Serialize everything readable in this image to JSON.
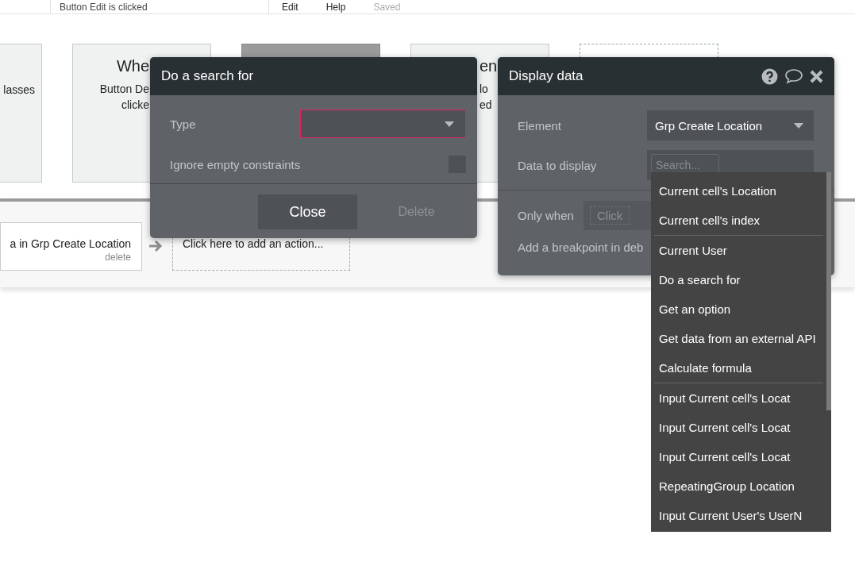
{
  "top_bar": {
    "event_name": "Button Edit is clicked",
    "menu": [
      "Edit",
      "Help"
    ],
    "save_status": "Saved"
  },
  "event_cards": [
    {
      "kind": "text",
      "lines": [
        "lasses"
      ]
    },
    {
      "kind": "text",
      "heading": "Whe",
      "lines": [
        "Button De",
        "clicke"
      ]
    },
    {
      "kind": "selected"
    },
    {
      "kind": "text",
      "heading": "en",
      "lines": [
        "lo",
        "ed"
      ]
    },
    {
      "kind": "empty"
    }
  ],
  "actions": {
    "step": {
      "label": "a in Grp Create Location",
      "delete": "delete"
    },
    "add_action": "Click here to add an action..."
  },
  "search_popup": {
    "title": "Do a search for",
    "type_label": "Type",
    "type_invalid": true,
    "ignore_label": "Ignore empty constraints",
    "ignore_checked": false,
    "close": "Close",
    "delete": "Delete"
  },
  "display_popup": {
    "title": "Display data",
    "element_label": "Element",
    "element_value": "Grp Create Location",
    "data_label": "Data to display",
    "search_placeholder": "Search...",
    "only_when_label": "Only when",
    "only_when_placeholder": "Click",
    "breakpoint_label": "Add a breakpoint in deb"
  },
  "suggestions": [
    [
      "Current cell's Location",
      "Current cell's index"
    ],
    [
      "Current User",
      "Do a search for",
      "Get an option",
      "Get data from an external API",
      "Calculate formula"
    ],
    [
      "Input Current cell's Locat",
      "Input Current cell's Locat",
      "Input Current cell's Locat",
      "RepeatingGroup Location",
      "Input Current User's UserN"
    ]
  ]
}
